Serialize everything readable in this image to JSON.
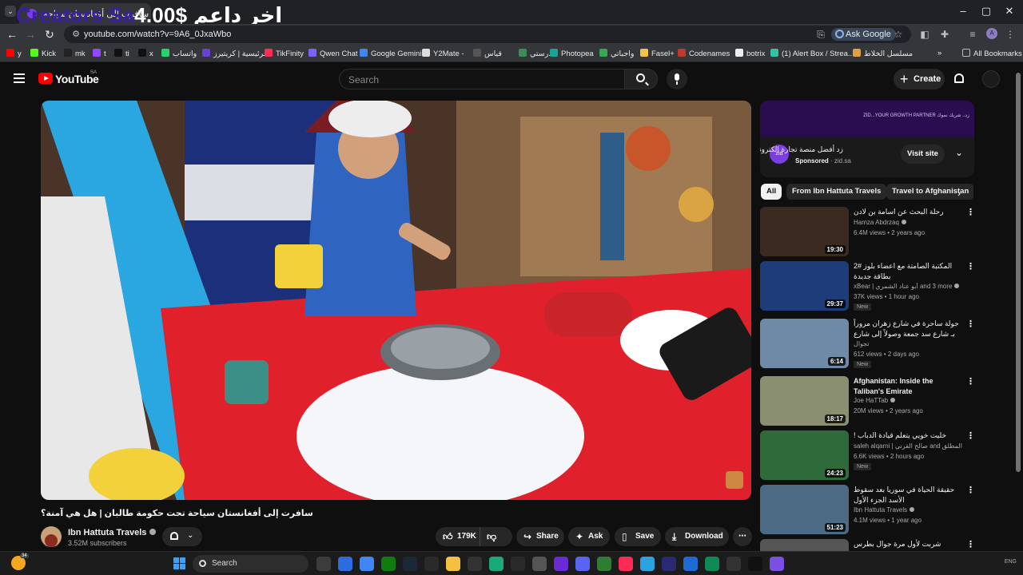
{
  "browser": {
    "tab_title": "سافرت إلى أفغانستان سياحة",
    "tab_close": "✕",
    "overlay": {
      "brand": "Creators Sa",
      "price": "4.00$",
      "arabic": "اخر داعم"
    },
    "window_controls": {
      "minimize": "–",
      "maximize": "▢",
      "close": "✕"
    },
    "url": "youtube.com/watch?v=9A6_0JxaWbo",
    "ask_google": "Ask Google",
    "profile_initial": "A",
    "bookmarks": [
      {
        "label": "y",
        "color": "#ff0000"
      },
      {
        "label": "Kick",
        "color": "#53fc18"
      },
      {
        "label": "mk",
        "color": "#222222"
      },
      {
        "label": "t",
        "color": "#9146ff"
      },
      {
        "label": "ti",
        "color": "#111111"
      },
      {
        "label": "x",
        "color": "#111111"
      },
      {
        "label": "واتساب",
        "color": "#25d366"
      },
      {
        "label": "الرئيسية | كريتيرز",
        "color": "#6a3fd6"
      },
      {
        "label": "TikFinity",
        "color": "#ff2d55"
      },
      {
        "label": "Qwen Chat",
        "color": "#7b61ff"
      },
      {
        "label": "Google Gemini",
        "color": "#4285f4"
      },
      {
        "label": "Y2Mate -",
        "color": "#dddddd"
      },
      {
        "label": "قياس",
        "color": "#555555"
      },
      {
        "label": "مدرستي",
        "color": "#3c8c5a"
      },
      {
        "label": "Photopea",
        "color": "#18a497"
      },
      {
        "label": "واجباتي",
        "color": "#34a853"
      },
      {
        "label": "Fasel+",
        "color": "#f2c14e"
      },
      {
        "label": "Codenames",
        "color": "#c0392b"
      },
      {
        "label": "botrix",
        "color": "#eeeeee"
      },
      {
        "label": "(1) Alert Box / Strea...",
        "color": "#31c3a2"
      },
      {
        "label": "مسلسل الخلاط",
        "color": "#e0a040"
      }
    ],
    "all_bookmarks": "All Bookmarks"
  },
  "youtube": {
    "logo_text": "YouTube",
    "country_code": "SA",
    "search_placeholder": "Search",
    "create_label": "Create"
  },
  "video": {
    "title": "سافرت إلى أفغانستان سياحة تحت حكومة طالبان | هل هي آمنة؟",
    "channel": "Ibn Hattuta Travels",
    "subscribers": "3.52M subscribers",
    "likes": "179K",
    "share": "Share",
    "ask": "Ask",
    "save": "Save",
    "download": "Download",
    "more": "⋯"
  },
  "ad": {
    "banner_text": "زد.. شريك نموك ZID...YOUR GROWTH PARTNER",
    "logo": "zid",
    "title": "زد أفضل منصة تجارة الكترونية",
    "sponsored": "Sponsored",
    "domain": "zid.sa",
    "visit": "Visit site"
  },
  "chips": [
    "All",
    "From Ibn Hattuta Travels",
    "Travel to Afghanistan"
  ],
  "recommendations": [
    {
      "title": "رحلة البحث عن اسامة بن لادن",
      "rtl": true,
      "channel": "Hamza Abdrzaq",
      "verified": true,
      "meta": "6.4M views • 2 years ago",
      "duration": "19:30",
      "badge": "",
      "thumb": "#3b2a20"
    },
    {
      "title": "المكتبة الصامتة مع اعضاء بلوز #2 بطاقة جديدة",
      "rtl": true,
      "channel": "xBear | أبو عناد الشمري and 3 more",
      "verified": true,
      "meta": "37K views • 1 hour ago",
      "duration": "29:37",
      "badge": "New",
      "thumb": "#1f3c7a"
    },
    {
      "title": "جولة ساحرة في شارع زهران مروراً بـ شارع سد جمعة وصولاً إلى شارع الملكة نور",
      "rtl": true,
      "channel": "تجوال",
      "verified": false,
      "meta": "612 views • 2 days ago",
      "duration": "6:14",
      "badge": "New",
      "thumb": "#6f8aa6"
    },
    {
      "title": "Afghanistan: Inside the Taliban's Emirate",
      "rtl": false,
      "channel": "Joe HaTTab",
      "verified": true,
      "meta": "20M views • 2 years ago",
      "duration": "18:17",
      "badge": "",
      "thumb": "#8a8f72"
    },
    {
      "title": "خليت خويي يتعلم قيادة الدباب !",
      "rtl": true,
      "channel": "saleh alqarni | صالح القرني and زيد المطلق",
      "verified": true,
      "meta": "6.6K views • 2 hours ago",
      "duration": "24:23",
      "badge": "New",
      "thumb": "#2f6b3a"
    },
    {
      "title": "حقيقة الحياة في سوريا بعد سقوط الأسد الجزء الأول",
      "rtl": true,
      "channel": "Ibn Hattuta Travels",
      "verified": true,
      "meta": "4.1M views • 1 year ago",
      "duration": "51:23",
      "badge": "",
      "thumb": "#4d6a84"
    },
    {
      "title": "شربت لأول مرة جوال بطرس اليوتيوب",
      "rtl": true,
      "channel": "",
      "verified": false,
      "meta": "",
      "duration": "",
      "badge": "",
      "thumb": "#555555"
    }
  ],
  "taskbar": {
    "search_label": "Search",
    "weather_temp": "34",
    "apps": [
      {
        "name": "file-explorer",
        "color": "#3c3c3c"
      },
      {
        "name": "photos",
        "color": "#2d6cdf"
      },
      {
        "name": "chrome",
        "color": "#4285f4"
      },
      {
        "name": "xbox",
        "color": "#107c10"
      },
      {
        "name": "steam",
        "color": "#1b2838"
      },
      {
        "name": "epic",
        "color": "#2a2a2a"
      },
      {
        "name": "folder",
        "color": "#f3c044"
      },
      {
        "name": "obs",
        "color": "#333333"
      },
      {
        "name": "copilot",
        "color": "#1ba97a"
      },
      {
        "name": "media",
        "color": "#2a2a2a"
      },
      {
        "name": "capcut",
        "color": "#555555"
      },
      {
        "name": "bandlab",
        "color": "#6a2bd6"
      },
      {
        "name": "discord",
        "color": "#5865f2"
      },
      {
        "name": "bot",
        "color": "#2e7d32"
      },
      {
        "name": "tiktok",
        "color": "#fe2c55"
      },
      {
        "name": "telegram",
        "color": "#2aa3e0"
      },
      {
        "name": "premiere",
        "color": "#2a2a72"
      },
      {
        "name": "app-blue",
        "color": "#1e6bd6"
      },
      {
        "name": "app-green",
        "color": "#0e8a55"
      },
      {
        "name": "app-dark",
        "color": "#333333"
      },
      {
        "name": "app-x",
        "color": "#111111"
      },
      {
        "name": "app-pen",
        "color": "#7b4ee4"
      }
    ],
    "tray_text": "ENG"
  }
}
